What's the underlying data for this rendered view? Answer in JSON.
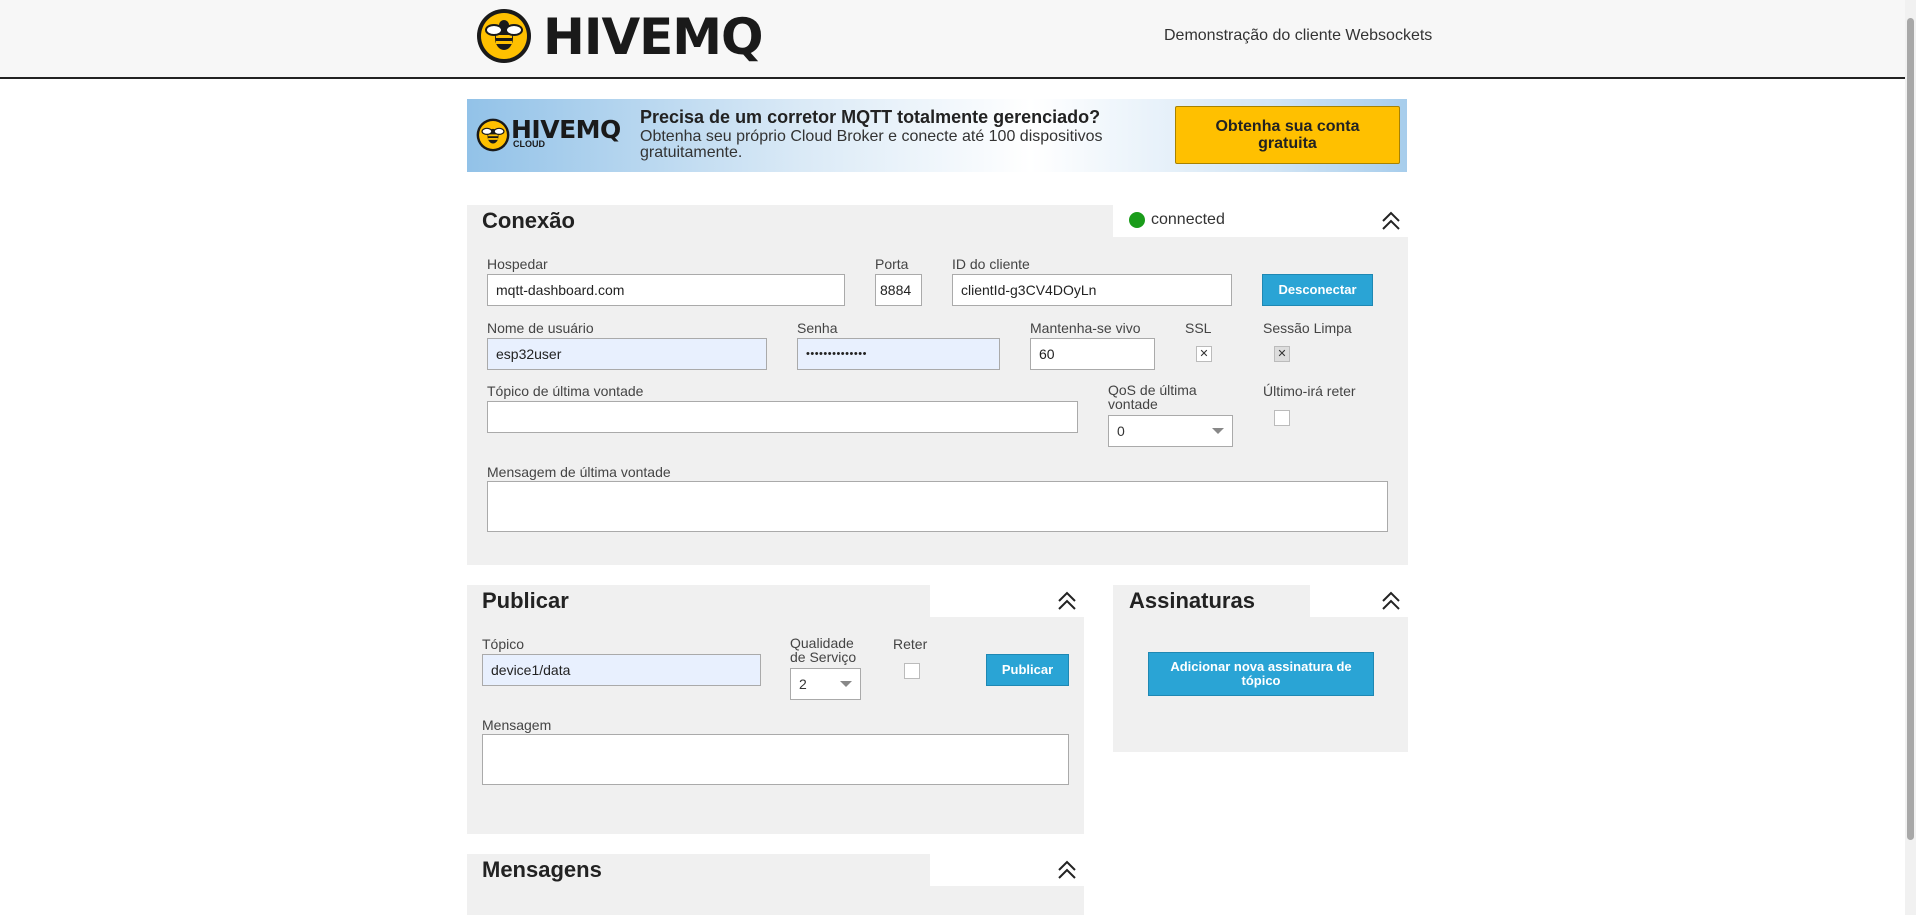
{
  "header": {
    "logo_text": "HIVEMQ",
    "title": "Demonstração do cliente Websockets"
  },
  "banner": {
    "logo_text": "HIVEMQ",
    "logo_sub": "CLOUD",
    "heading": "Precisa de um corretor MQTT totalmente gerenciado?",
    "text": "Obtenha seu próprio Cloud Broker e conecte até 100 dispositivos gratuitamente.",
    "cta_label": "Obtenha sua conta gratuita"
  },
  "connection": {
    "title": "Conexão",
    "status_text": "connected",
    "status_color": "#1a9c1a",
    "host_label": "Hospedar",
    "host_value": "mqtt-dashboard.com",
    "port_label": "Porta",
    "port_value": "8884",
    "client_id_label": "ID do cliente",
    "client_id_value": "clientId-g3CV4DOyLn",
    "disconnect_label": "Desconectar",
    "username_label": "Nome de usuário",
    "username_value": "esp32user",
    "password_label": "Senha",
    "password_value": "••••••••••••••",
    "keepalive_label": "Mantenha-se vivo",
    "keepalive_value": "60",
    "ssl_label": "SSL",
    "ssl_mark": "✕",
    "clean_session_label": "Sessão Limpa",
    "clean_session_mark": "✕",
    "lwt_topic_label": "Tópico de última vontade",
    "lwt_topic_value": "",
    "lwt_qos_label": "QoS de última vontade",
    "lwt_qos_value": "0",
    "lwt_retain_label": "Último-irá reter",
    "lwt_message_label": "Mensagem de última vontade"
  },
  "publish": {
    "title": "Publicar",
    "topic_label": "Tópico",
    "topic_value": "device1/data",
    "qos_label": "Qualidade de Serviço",
    "qos_value": "2",
    "retain_label": "Reter",
    "publish_label": "Publicar",
    "message_label": "Mensagem"
  },
  "subscriptions": {
    "title": "Assinaturas",
    "add_label": "Adicionar nova assinatura de tópico"
  },
  "messages": {
    "title": "Mensagens"
  }
}
